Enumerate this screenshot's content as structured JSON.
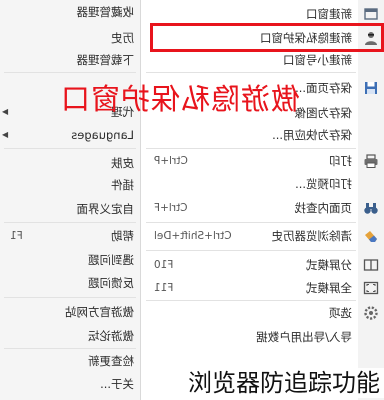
{
  "menu": {
    "main_items": [
      {
        "label": "新建窗口",
        "icon": "new-window-icon"
      },
      {
        "label": "新建隐私保护窗口",
        "icon": "privacy-icon"
      },
      {
        "label": "新建小号窗口"
      },
      {
        "label": "保存页面...",
        "icon": "save-icon"
      },
      {
        "label": "保存为图像"
      },
      {
        "label": "保存为快应用..."
      },
      {
        "label": "打印",
        "shortcut": "Ctrl+P",
        "icon": "print-icon"
      },
      {
        "label": "打印预览..."
      },
      {
        "label": "页面内查找",
        "shortcut": "Ctrl+F",
        "icon": "find-icon"
      },
      {
        "label": "清除浏览器历史",
        "shortcut": "Ctrl+Shift+Del",
        "icon": "clear-history-icon"
      },
      {
        "label": "分屏模式",
        "shortcut": "F10",
        "icon": "split-screen-icon"
      },
      {
        "label": "全屏模式",
        "shortcut": "F11",
        "icon": "fullscreen-icon"
      },
      {
        "label": "选项",
        "icon": "options-icon"
      },
      {
        "label": "导入/导出用户数据"
      }
    ],
    "side_items": [
      {
        "label": "收藏管理器"
      },
      {
        "label": "历史"
      },
      {
        "label": "下载管理器"
      },
      {
        "label": "代理",
        "has_submenu": true
      },
      {
        "label": "Languages",
        "has_submenu": true
      },
      {
        "label": "皮肤"
      },
      {
        "label": "插件"
      },
      {
        "label": "自定义界面"
      },
      {
        "label": "帮助",
        "shortcut": "F1"
      },
      {
        "label": "遇到问题"
      },
      {
        "label": "反馈问题"
      },
      {
        "label": "傲游官方网站"
      },
      {
        "label": "傲游论坛"
      },
      {
        "label": "检查更新"
      },
      {
        "label": "关于..."
      }
    ],
    "submenu_arrow": "▶"
  },
  "annotation": {
    "text": "傲游隐私保护窗口",
    "color": "#e8141c"
  },
  "caption": "浏览器防追踪功能"
}
